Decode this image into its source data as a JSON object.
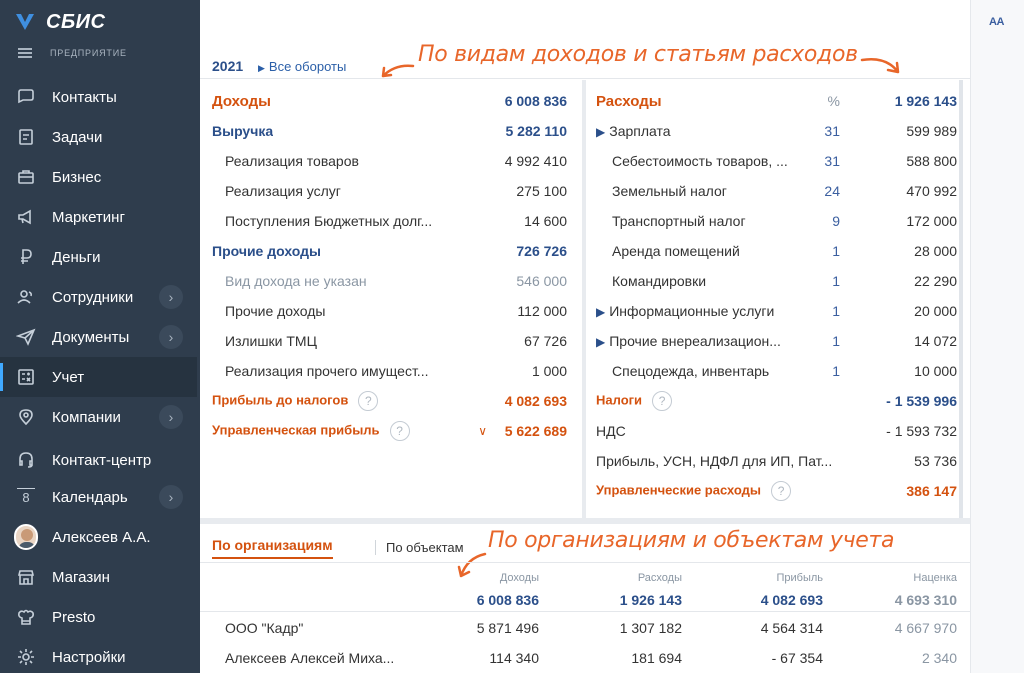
{
  "app": {
    "name": "СБИС",
    "section": "ПРЕДПРИЯТИЕ"
  },
  "sidebar": {
    "items": [
      {
        "label": "Контакты",
        "icon": "chat-icon",
        "chevron": false
      },
      {
        "label": "Задачи",
        "icon": "tasks-icon",
        "chevron": false
      },
      {
        "label": "Бизнес",
        "icon": "briefcase-icon",
        "chevron": false
      },
      {
        "label": "Маркетинг",
        "icon": "megaphone-icon",
        "chevron": false
      },
      {
        "label": "Деньги",
        "icon": "ruble-icon",
        "chevron": false
      },
      {
        "label": "Сотрудники",
        "icon": "people-icon",
        "chevron": true
      },
      {
        "label": "Документы",
        "icon": "paper-plane-icon",
        "chevron": true
      },
      {
        "label": "Учет",
        "icon": "calculator-icon",
        "chevron": false,
        "active": true
      },
      {
        "label": "Компании",
        "icon": "map-pin-icon",
        "chevron": true
      },
      {
        "label": "Контакт-центр",
        "icon": "headset-icon",
        "chevron": false
      },
      {
        "label": "Календарь",
        "icon": "calendar-icon",
        "badge": "8",
        "chevron": true
      },
      {
        "label": "Алексеев А.А.",
        "icon": "avatar",
        "chevron": false
      },
      {
        "label": "Магазин",
        "icon": "store-icon",
        "chevron": false
      },
      {
        "label": "Presto",
        "icon": "chef-hat-icon",
        "chevron": false
      },
      {
        "label": "Настройки",
        "icon": "gear-icon",
        "chevron": false
      }
    ]
  },
  "toolbar": {
    "font_size_label": "AA"
  },
  "header": {
    "year": "2021",
    "all_turnover": "Все обороты"
  },
  "annotations": {
    "top": "По видам доходов и статьям расходов",
    "bottom": "По организациям и объектам учета"
  },
  "income": {
    "title": "Доходы",
    "total": "6 008 836",
    "groups": {
      "revenue": {
        "label": "Выручка",
        "value": "5 282 110"
      },
      "revenue_items": [
        {
          "label": "Реализация товаров",
          "value": "4 992 410"
        },
        {
          "label": "Реализация услуг",
          "value": "275 100"
        },
        {
          "label": "Поступления Бюджетных долг...",
          "value": "14 600"
        }
      ],
      "other": {
        "label": "Прочие доходы",
        "value": "726 726"
      },
      "other_items": [
        {
          "label": "Вид дохода не указан",
          "value": "546 000",
          "muted": true
        },
        {
          "label": "Прочие доходы",
          "value": "112 000"
        },
        {
          "label": "Излишки ТМЦ",
          "value": "67 726"
        },
        {
          "label": "Реализация прочего имущест...",
          "value": "1 000"
        }
      ]
    },
    "profit_before_tax": {
      "label": "Прибыль до налогов",
      "value": "4 082 693"
    },
    "managerial_profit": {
      "label": "Управленческая прибыль",
      "value": "5 622 689"
    }
  },
  "expenses": {
    "title": "Расходы",
    "pct_label": "%",
    "total": "1 926 143",
    "items": [
      {
        "label": "Зарплата",
        "pct": "31",
        "value": "599 989",
        "expandable": true
      },
      {
        "label": "Себестоимость товаров, ...",
        "pct": "31",
        "value": "588 800",
        "expandable": false
      },
      {
        "label": "Земельный налог",
        "pct": "24",
        "value": "470 992",
        "expandable": false
      },
      {
        "label": "Транспортный налог",
        "pct": "9",
        "value": "172 000",
        "expandable": false
      },
      {
        "label": "Аренда помещений",
        "pct": "1",
        "value": "28 000",
        "expandable": false
      },
      {
        "label": "Командировки",
        "pct": "1",
        "value": "22 290",
        "expandable": false
      },
      {
        "label": "Информационные услуги",
        "pct": "1",
        "value": "20 000",
        "expandable": true
      },
      {
        "label": "Прочие внереализацион...",
        "pct": "1",
        "value": "14 072",
        "expandable": true
      },
      {
        "label": "Спецодежда, инвентарь",
        "pct": "1",
        "value": "10 000",
        "expandable": false
      }
    ],
    "taxes": {
      "label": "Налоги",
      "value": "- 1 539 996"
    },
    "tax_items": [
      {
        "label": "НДС",
        "value": "- 1 593 732"
      },
      {
        "label": "Прибыль, УСН, НДФЛ для ИП, Пат...",
        "value": "53 736"
      }
    ],
    "managerial_expenses": {
      "label": "Управленческие расходы",
      "value": "386 147"
    }
  },
  "bottom": {
    "tabs": [
      "По организациям",
      "По объектам"
    ],
    "columns": [
      "Доходы",
      "Расходы",
      "Прибыль",
      "Наценка"
    ],
    "totals": [
      "6 008 836",
      "1 926 143",
      "4 082 693",
      "4 693 310"
    ],
    "rows": [
      {
        "name": "ООО \"Кадр\"",
        "values": [
          "5 871 496",
          "1 307 182",
          "4 564 314",
          "4 667 970"
        ]
      },
      {
        "name": "Алексеев Алексей Миха...",
        "values": [
          "114 340",
          "181 694",
          "- 67 354",
          "2 340"
        ]
      }
    ]
  }
}
